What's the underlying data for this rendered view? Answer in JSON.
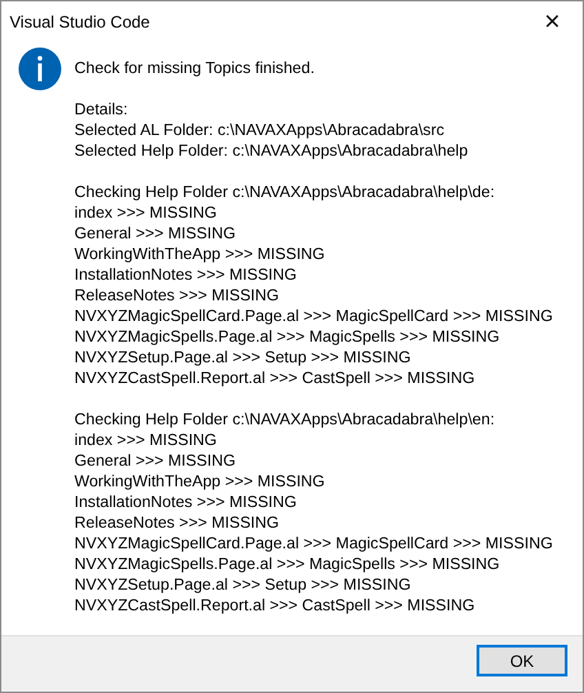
{
  "window": {
    "title": "Visual Studio Code",
    "close": "×"
  },
  "message": {
    "headline": "Check for missing Topics finished.",
    "sections": [
      {
        "lines": [
          "Details:",
          "Selected AL Folder: c:\\NAVAXApps\\Abracadabra\\src",
          "Selected Help Folder: c:\\NAVAXApps\\Abracadabra\\help"
        ]
      },
      {
        "lines": [
          "Checking Help Folder c:\\NAVAXApps\\Abracadabra\\help\\de:",
          "index >>> MISSING",
          "General >>> MISSING",
          "WorkingWithTheApp >>> MISSING",
          "InstallationNotes >>> MISSING",
          "ReleaseNotes >>> MISSING",
          "NVXYZMagicSpellCard.Page.al >>> MagicSpellCard >>> MISSING",
          "NVXYZMagicSpells.Page.al >>> MagicSpells >>> MISSING",
          "NVXYZSetup.Page.al >>> Setup >>> MISSING",
          "NVXYZCastSpell.Report.al >>> CastSpell >>> MISSING"
        ]
      },
      {
        "lines": [
          "Checking Help Folder c:\\NAVAXApps\\Abracadabra\\help\\en:",
          "index >>> MISSING",
          "General >>> MISSING",
          "WorkingWithTheApp >>> MISSING",
          "InstallationNotes >>> MISSING",
          "ReleaseNotes >>> MISSING",
          "NVXYZMagicSpellCard.Page.al >>> MagicSpellCard >>> MISSING",
          "NVXYZMagicSpells.Page.al >>> MagicSpells >>> MISSING",
          "NVXYZSetup.Page.al >>> Setup >>> MISSING",
          "NVXYZCastSpell.Report.al >>> CastSpell >>> MISSING"
        ]
      }
    ]
  },
  "buttons": [
    {
      "label": "OK",
      "default": true
    }
  ]
}
